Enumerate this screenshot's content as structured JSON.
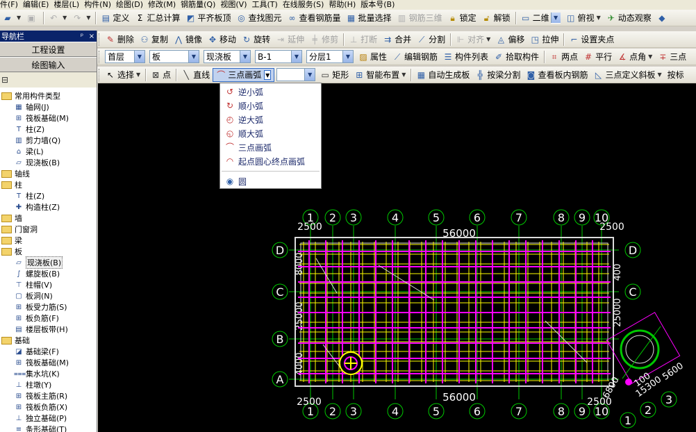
{
  "menubar": [
    "件(F)",
    "编辑(E)",
    "楼层(L)",
    "构件(N)",
    "绘图(D)",
    "修改(M)",
    "钢筋量(Q)",
    "视图(V)",
    "工具(T)",
    "在线服务(S)",
    "帮助(H)",
    "版本号(B)"
  ],
  "toolbar1": {
    "define": "定义",
    "sum_calc": "汇总计算",
    "flush_top": "平齐板顶",
    "find_element": "查找图元",
    "view_rebar": "查看钢筋量",
    "batch_select": "批量选择",
    "rebar_3d": "钢筋三维",
    "lock": "锁定",
    "unlock": "解锁",
    "view_mode": "二维",
    "top_view": "俯视",
    "dynamic_view": "动态观察",
    "sigma": "Σ"
  },
  "toolbar2": {
    "delete": "删除",
    "copy": "复制",
    "mirror": "镜像",
    "move": "移动",
    "rotate": "旋转",
    "extend": "延伸",
    "trim": "修剪",
    "break": "打断",
    "merge": "合并",
    "split": "分割",
    "align": "对齐",
    "offset": "偏移",
    "stretch": "拉伸",
    "set_grip": "设置夹点"
  },
  "toolbar3": {
    "floor": "首层",
    "category": "板",
    "type": "现浇板",
    "element": "B-1",
    "layer": "分层1",
    "attributes": "属性",
    "edit_rebar": "编辑钢筋",
    "element_list": "构件列表",
    "pick_element": "拾取构件",
    "two_point": "两点",
    "parallel": "平行",
    "point_angle": "点角",
    "three_point": "三点"
  },
  "toolbar4": {
    "select": "选择",
    "point": "点",
    "line": "直线",
    "arc_mode": "三点画弧",
    "rect": "矩形",
    "smart_layout": "智能布置",
    "auto_slab": "自动生成板",
    "split_by_beam": "按梁分割",
    "view_slab_rebar": "查看板内钢筋",
    "three_point_slope": "三点定义斜板",
    "by_mark": "按标"
  },
  "sidebar": {
    "title": "导航栏",
    "pin": "ᵖ",
    "close": "×",
    "project_settings": "工程设置",
    "drawing_input": "绘图输入",
    "tree": [
      {
        "level": 1,
        "folder": true,
        "label": "常用构件类型"
      },
      {
        "level": 2,
        "icon": "grid",
        "label": "轴网(J)"
      },
      {
        "level": 2,
        "icon": "raft",
        "label": "筏板基础(M)"
      },
      {
        "level": 2,
        "icon": "column",
        "label": "柱(Z)"
      },
      {
        "level": 2,
        "icon": "shearwall",
        "label": "剪力墙(Q)"
      },
      {
        "level": 2,
        "icon": "beam",
        "label": "梁(L)"
      },
      {
        "level": 2,
        "icon": "slab",
        "label": "现浇板(B)"
      },
      {
        "level": 1,
        "folder": true,
        "label": "轴线"
      },
      {
        "level": 1,
        "folder": true,
        "label": "柱"
      },
      {
        "level": 2,
        "icon": "column",
        "label": "柱(Z)"
      },
      {
        "level": 2,
        "icon": "cons-column",
        "label": "构造柱(Z)"
      },
      {
        "level": 1,
        "folder": true,
        "label": "墙"
      },
      {
        "level": 1,
        "folder": true,
        "label": "门窗洞"
      },
      {
        "level": 1,
        "folder": true,
        "label": "梁"
      },
      {
        "level": 1,
        "folder": true,
        "label": "板"
      },
      {
        "level": 2,
        "icon": "slab",
        "label": "现浇板(B)",
        "selected": true
      },
      {
        "level": 2,
        "icon": "spiral",
        "label": "螺旋板(B)"
      },
      {
        "level": 2,
        "icon": "cap",
        "label": "柱帽(V)"
      },
      {
        "level": 2,
        "icon": "hole",
        "label": "板洞(N)"
      },
      {
        "level": 2,
        "icon": "rebar",
        "label": "板受力筋(S)"
      },
      {
        "level": 2,
        "icon": "rebar",
        "label": "板负筋(F)"
      },
      {
        "level": 2,
        "icon": "band",
        "label": "楼层板带(H)"
      },
      {
        "level": 1,
        "folder": true,
        "label": "基础"
      },
      {
        "level": 2,
        "icon": "fbeam",
        "label": "基础梁(F)"
      },
      {
        "level": 2,
        "icon": "raft",
        "label": "筏板基础(M)"
      },
      {
        "level": 2,
        "icon": "pit",
        "label": "集水坑(K)"
      },
      {
        "level": 2,
        "icon": "pier",
        "label": "柱墩(Y)"
      },
      {
        "level": 2,
        "icon": "rebar",
        "label": "筏板主筋(R)"
      },
      {
        "level": 2,
        "icon": "rebar",
        "label": "筏板负筋(X)"
      },
      {
        "level": 2,
        "icon": "isolated",
        "label": "独立基础(P)"
      },
      {
        "level": 2,
        "icon": "strip",
        "label": "条形基础(T)"
      }
    ]
  },
  "arc_menu": [
    {
      "label": "逆小弧",
      "icon": "ccw-small-arc-icon"
    },
    {
      "label": "顺小弧",
      "icon": "cw-small-arc-icon"
    },
    {
      "label": "逆大弧",
      "icon": "ccw-large-arc-icon"
    },
    {
      "label": "顺大弧",
      "icon": "cw-large-arc-icon"
    },
    {
      "label": "三点画弧",
      "icon": "three-point-arc-icon"
    },
    {
      "label": "起点圆心终点画弧",
      "icon": "center-arc-icon"
    },
    {
      "label": "圆",
      "icon": "circle-icon",
      "separator_before": true
    }
  ],
  "canvas": {
    "axes_top": [
      "1",
      "2",
      "3",
      "4",
      "5",
      "6",
      "7",
      "8",
      "9",
      "10"
    ],
    "axes_bottom": [
      "1",
      "2",
      "3",
      "4",
      "5",
      "6",
      "7",
      "8",
      "9",
      "10"
    ],
    "axes_left": [
      "D",
      "C",
      "B",
      "A"
    ],
    "axes_right": [
      "D",
      "C"
    ],
    "overall_dim_top": "56000",
    "overall_dim_bottom": "56000",
    "dim_left_top": "2500",
    "dim_right_top": "2500",
    "dim_left_bottom": "2500",
    "dim_right_bottom": "2500",
    "dims_left": [
      "8000",
      "25000",
      "4000"
    ],
    "dims_right": [
      "400",
      "25000"
    ],
    "aux_axes": [
      "1",
      "2",
      "3"
    ],
    "aux_dims": [
      "5600",
      "15300",
      "100",
      "6800"
    ],
    "colors": {
      "axis": "#00c800",
      "dim": "#ffffff",
      "slab_line": "#ffff00",
      "rebar": "#ff00ff",
      "beam": "#dcdcdc"
    }
  }
}
